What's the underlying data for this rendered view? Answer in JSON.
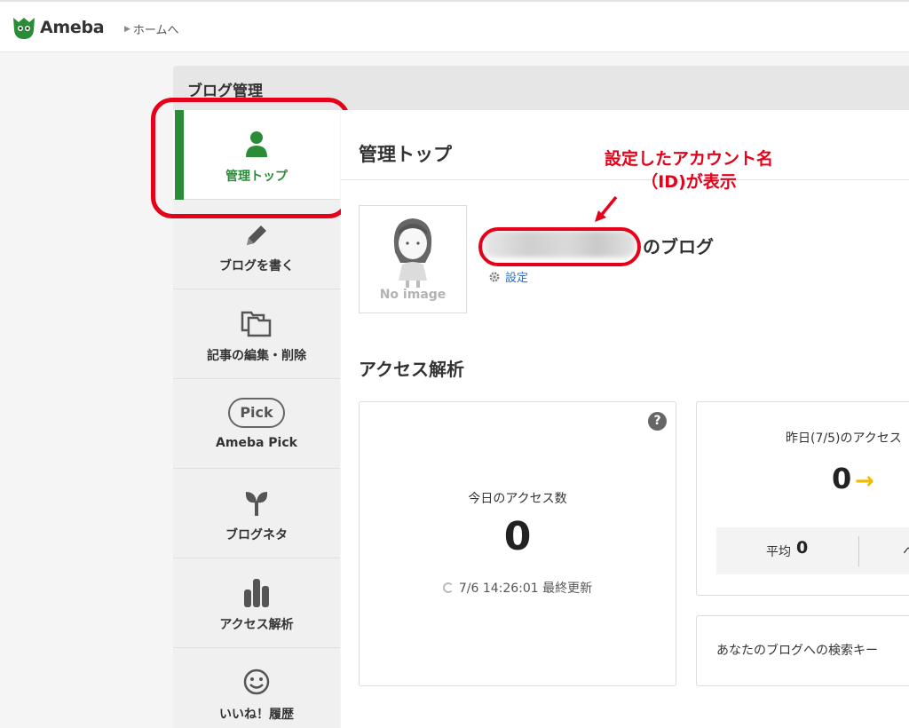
{
  "header": {
    "logo_text": "Ameba",
    "home_link": "ホームへ"
  },
  "admin": {
    "title": "ブログ管理"
  },
  "sidebar": {
    "items": [
      {
        "label": "管理トップ",
        "icon": "person-icon",
        "active": true
      },
      {
        "label": "ブログを書く",
        "icon": "pencil-icon"
      },
      {
        "label": "記事の編集・削除",
        "icon": "folders-icon"
      },
      {
        "label": "Ameba Pick",
        "icon": "pick-badge-icon",
        "badge": "Pick"
      },
      {
        "label": "ブログネタ",
        "icon": "sprout-icon"
      },
      {
        "label": "アクセス解析",
        "icon": "bar-chart-icon"
      },
      {
        "label": "いいね！履歴",
        "icon": "smiley-icon"
      }
    ]
  },
  "main": {
    "title": "管理トップ",
    "avatar_label": "No image",
    "blog_suffix": "のブログ",
    "settings_label": "設定",
    "annotation_line1": "設定したアカウント名",
    "annotation_line2": "（ID)が表示",
    "access_title": "アクセス解析",
    "today": {
      "help": "?",
      "label": "今日のアクセス数",
      "count": "0",
      "updated": "7/6 14:26:01 最終更新"
    },
    "yesterday": {
      "label": "昨日(7/5)のアクセス",
      "count": "0",
      "trend": "→",
      "avg_label": "平均",
      "avg_value": "0",
      "next_label": "へ"
    },
    "search": {
      "label": "あなたのブログへの検索キー"
    }
  },
  "colors": {
    "brand_green": "#2a8c36",
    "annotation_red": "#e6001a",
    "link_blue": "#2f6fb7",
    "trend_yellow": "#f4b800"
  }
}
